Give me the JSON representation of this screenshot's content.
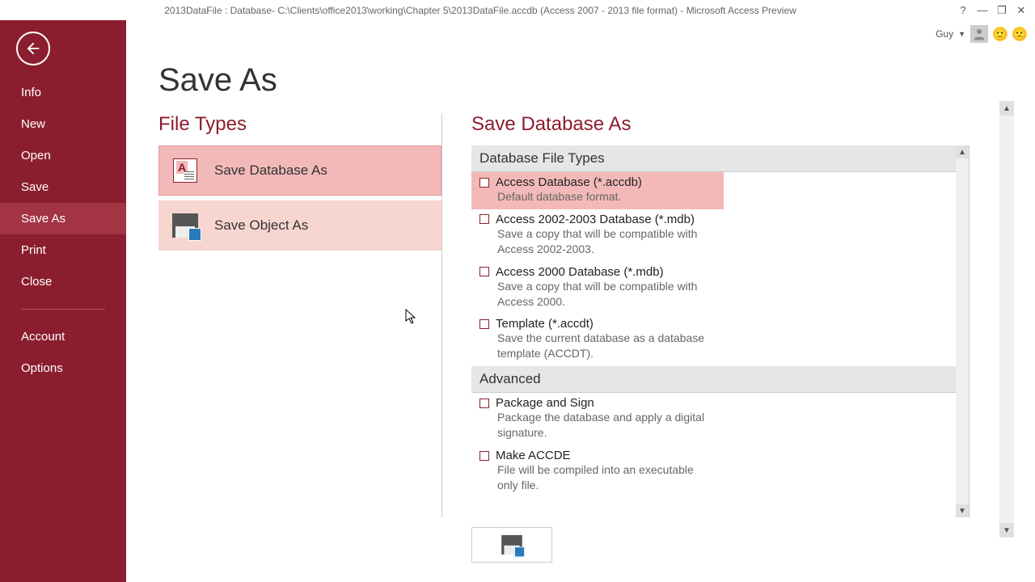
{
  "titlebar": {
    "title": "2013DataFile : Database- C:\\Clients\\office2013\\working\\Chapter 5\\2013DataFile.accdb (Access 2007 - 2013 file format) - Microsoft Access Preview"
  },
  "user": {
    "name": "Guy"
  },
  "sidebar": {
    "items": [
      "Info",
      "New",
      "Open",
      "Save",
      "Save As",
      "Print",
      "Close"
    ],
    "items2": [
      "Account",
      "Options"
    ],
    "active": "Save As"
  },
  "page": {
    "title": "Save As",
    "file_types_heading": "File Types",
    "file_types": [
      {
        "label": "Save Database As",
        "selected": true
      },
      {
        "label": "Save Object As",
        "selected": false
      }
    ],
    "right_heading": "Save Database As",
    "groups": [
      {
        "header": "Database File Types",
        "options": [
          {
            "title": "Access Database (*.accdb)",
            "desc": "Default database format.",
            "selected": true
          },
          {
            "title": "Access 2002-2003 Database (*.mdb)",
            "desc": "Save a copy that will be compatible with Access 2002-2003.",
            "selected": false
          },
          {
            "title": "Access 2000 Database (*.mdb)",
            "desc": "Save a copy that will be compatible with Access 2000.",
            "selected": false
          },
          {
            "title": "Template (*.accdt)",
            "desc": "Save the current database as a database template (ACCDT).",
            "selected": false
          }
        ]
      },
      {
        "header": "Advanced",
        "options": [
          {
            "title": "Package and Sign",
            "desc": "Package the database and apply a digital signature.",
            "selected": false
          },
          {
            "title": "Make ACCDE",
            "desc": "File will be compiled into an executable only file.",
            "selected": false
          }
        ]
      }
    ]
  }
}
